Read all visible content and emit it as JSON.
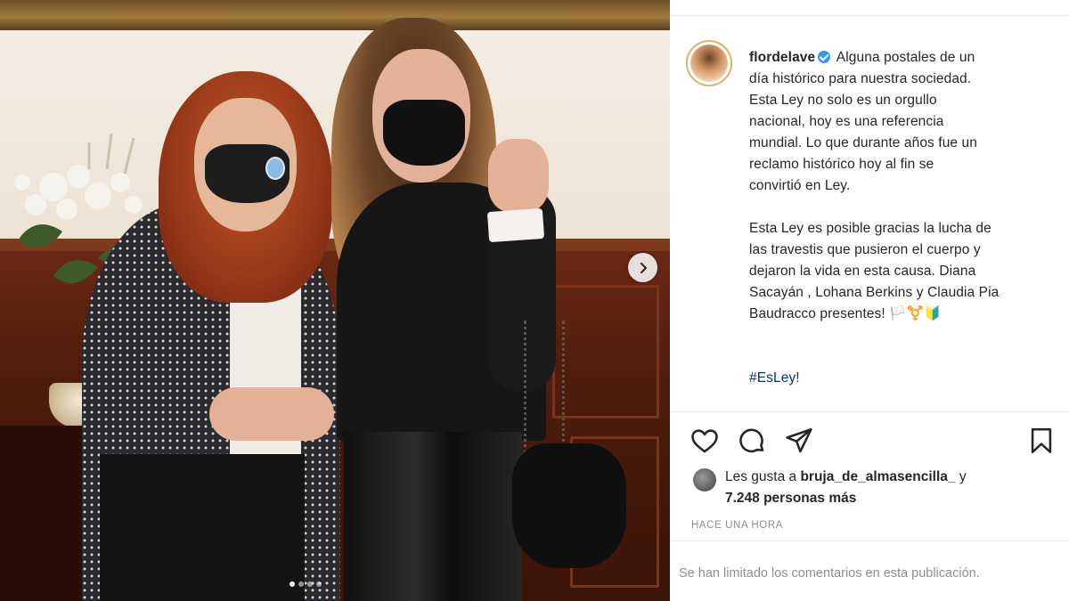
{
  "post": {
    "username": "flordelave",
    "verified": true,
    "caption_lines": [
      "Alguna postales de un",
      "día histórico para nuestra sociedad.",
      "Esta Ley no solo es un orgullo",
      "nacional, hoy es una referencia",
      "mundial. Lo que durante años fue un",
      "reclamo histórico hoy al fin se",
      "convirtió en Ley."
    ],
    "caption_lines_2": [
      "Esta Ley es posible gracias la lucha de",
      "las travestis que pusieron el cuerpo y",
      "dejaron la vida en esta causa. Diana",
      "Sacayán , Lohana Berkins y Claudia Pia",
      "Baudracco presentes! 🏳️⚧️🔰"
    ],
    "hashtag": "#EsLey!",
    "likes": {
      "prefix": "Les gusta a",
      "user": "bruja_de_almasencilla_",
      "conj": "y",
      "count": "7.248 personas más"
    },
    "time_ago": "HACE UNA HORA",
    "comments_limited": "Se han limitado los comentarios en esta publicación."
  },
  "carousel": {
    "total": 4,
    "active_index": 0
  },
  "icons": {
    "like": "heart-icon",
    "comment": "comment-icon",
    "share": "share-icon",
    "save": "bookmark-icon",
    "next": "chevron-right-icon"
  },
  "colors": {
    "text": "#262626",
    "muted": "#8e8e8e",
    "link": "#00376b",
    "verified": "#3897f0"
  }
}
